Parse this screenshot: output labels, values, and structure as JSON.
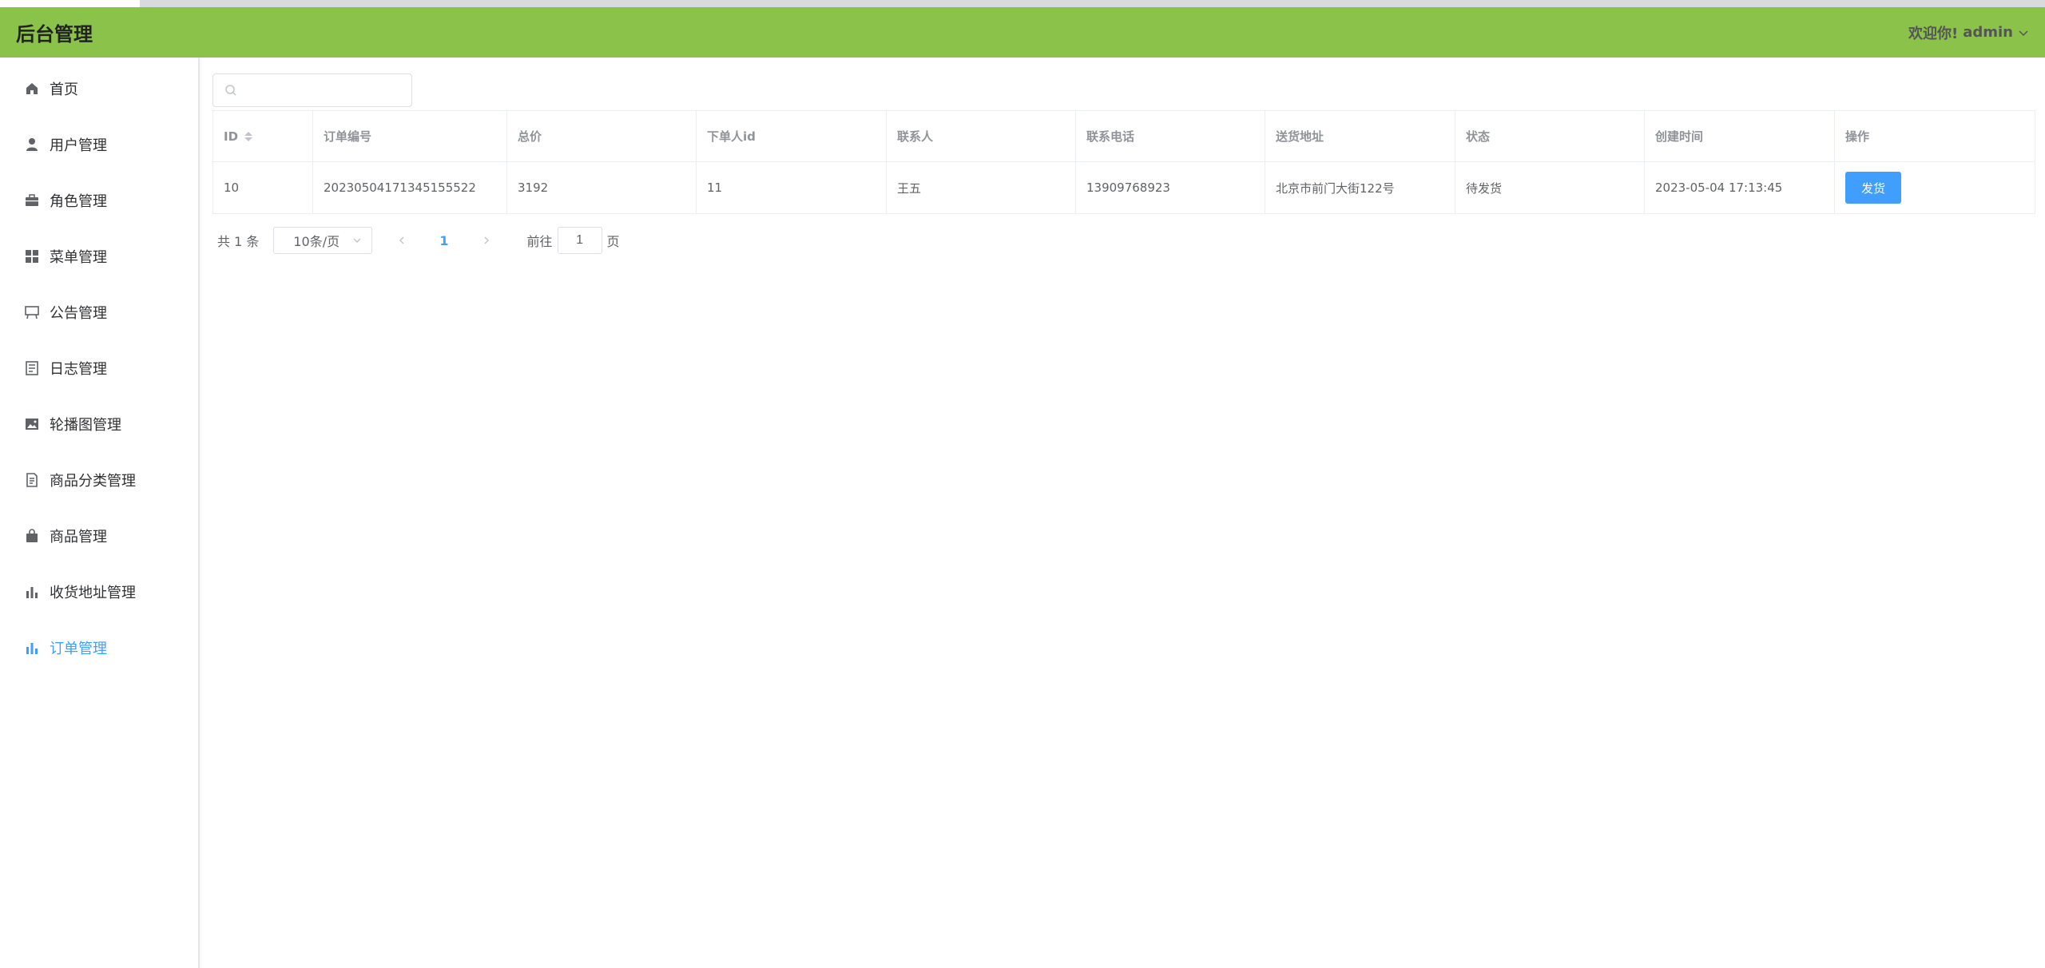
{
  "header": {
    "brand": "后台管理",
    "welcome": "欢迎你!",
    "username": "admin"
  },
  "sidebar": {
    "items": [
      {
        "label": "首页",
        "icon": "home-icon"
      },
      {
        "label": "用户管理",
        "icon": "user-icon"
      },
      {
        "label": "角色管理",
        "icon": "briefcase-icon"
      },
      {
        "label": "菜单管理",
        "icon": "grid-icon"
      },
      {
        "label": "公告管理",
        "icon": "board-icon"
      },
      {
        "label": "日志管理",
        "icon": "log-icon"
      },
      {
        "label": "轮播图管理",
        "icon": "image-icon"
      },
      {
        "label": "商品分类管理",
        "icon": "document-icon"
      },
      {
        "label": "商品管理",
        "icon": "bag-icon"
      },
      {
        "label": "收货地址管理",
        "icon": "bar-chart-icon"
      },
      {
        "label": "订单管理",
        "icon": "bar-chart-icon",
        "active": true
      }
    ]
  },
  "search": {
    "placeholder": "",
    "value": ""
  },
  "table": {
    "columns": [
      "ID",
      "订单编号",
      "总价",
      "下单人id",
      "联系人",
      "联系电话",
      "送货地址",
      "状态",
      "创建时间",
      "操作"
    ],
    "rows": [
      {
        "id": "10",
        "order_no": "20230504171345155522",
        "total": "3192",
        "user_id": "11",
        "contact": "王五",
        "phone": "13909768923",
        "address": "北京市前门大街122号",
        "status": "待发货",
        "created": "2023-05-04 17:13:45",
        "action": "发货"
      }
    ]
  },
  "pagination": {
    "total_text": "共 1 条",
    "page_size": "10条/页",
    "current_page": "1",
    "goto_label": "前往",
    "goto_value": "1",
    "page_suffix": "页"
  },
  "colors": {
    "header_bg": "#8bc34a",
    "accent": "#409eff"
  }
}
